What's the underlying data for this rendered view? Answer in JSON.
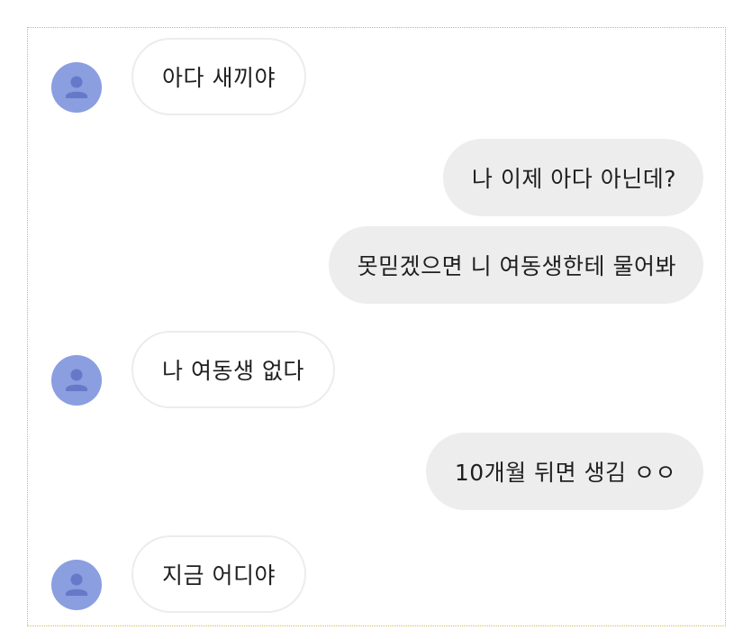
{
  "chat": {
    "messages": [
      {
        "sender": "them",
        "text": "아다 새끼야"
      },
      {
        "sender": "me",
        "text": "나 이제 아다 아닌데?"
      },
      {
        "sender": "me",
        "text": "못믿겠으면 니 여동생한테 물어봐"
      },
      {
        "sender": "them",
        "text": "나 여동생 없다"
      },
      {
        "sender": "me",
        "text": "10개월 뒤면 생김 ㅇㅇ"
      },
      {
        "sender": "them",
        "text": "지금 어디야"
      }
    ],
    "avatar_icon": "person-icon",
    "colors": {
      "avatar_bg": "#8a9ee0",
      "avatar_figure": "#6679c9",
      "outgoing_bubble": "#ededed",
      "incoming_bubble": "#ffffff",
      "frame_border": "#d8b64a"
    }
  }
}
